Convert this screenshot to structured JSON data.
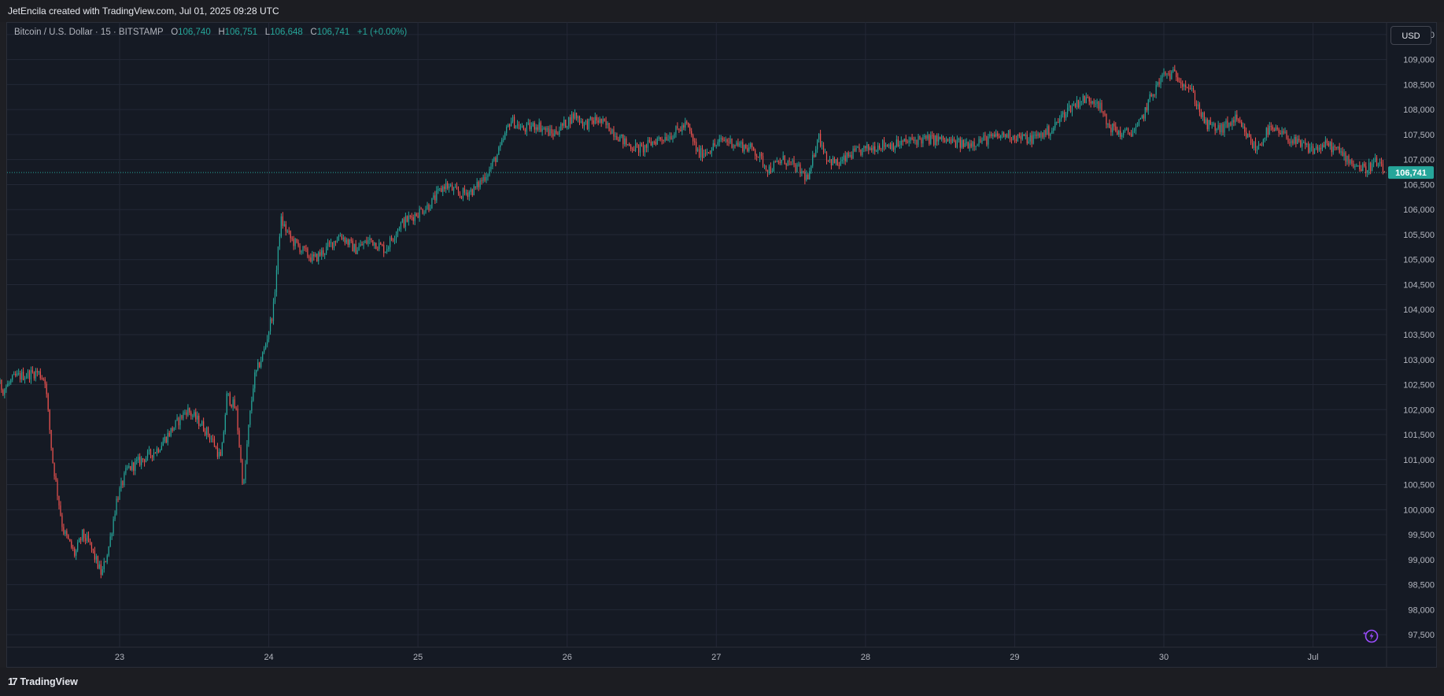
{
  "header": {
    "credit": "JetEncila created with TradingView.com, Jul 01, 2025 09:28 UTC"
  },
  "legend": {
    "symbol": "Bitcoin / U.S. Dollar · 15 · BITSTAMP",
    "o_label": "O",
    "o": "106,740",
    "h_label": "H",
    "h": "106,751",
    "l_label": "L",
    "l": "106,648",
    "c_label": "C",
    "c": "106,741",
    "change": "+1 (+0.00%)"
  },
  "currency_button": "USD",
  "last_price_label": "106,741",
  "footer": {
    "brand": "TradingView",
    "brand_mark": "17"
  },
  "icons": {
    "bolt": "lightning-icon"
  },
  "colors": {
    "up": "#26a69a",
    "down": "#ef5350",
    "background": "#151a24",
    "grid": "#232836"
  },
  "chart_data": {
    "type": "candlestick",
    "title": "Bitcoin / U.S. Dollar · 15 · BITSTAMP",
    "interval": "15",
    "ylim": [
      97250,
      109750
    ],
    "y_ticks": [
      97500,
      98000,
      98500,
      99000,
      99500,
      100000,
      100500,
      101000,
      101500,
      102000,
      102500,
      103000,
      103500,
      104000,
      104500,
      105000,
      105500,
      106000,
      106500,
      107000,
      107500,
      108000,
      108500,
      109000,
      109500
    ],
    "y_tick_labels": [
      "97,500",
      "98,000",
      "98,500",
      "99,000",
      "99,500",
      "100,000",
      "100,500",
      "101,000",
      "101,500",
      "102,000",
      "102,500",
      "103,000",
      "103,500",
      "104,000",
      "104,500",
      "105,000",
      "105,500",
      "106,000",
      "106,500",
      "107,000",
      "107,500",
      "108,000",
      "108,500",
      "109,000",
      "109,500"
    ],
    "x_ticks": [
      {
        "label": "23",
        "day": 23
      },
      {
        "label": "24",
        "day": 24
      },
      {
        "label": "25",
        "day": 25
      },
      {
        "label": "26",
        "day": 26
      },
      {
        "label": "27",
        "day": 27
      },
      {
        "label": "28",
        "day": 28
      },
      {
        "label": "29",
        "day": 29
      },
      {
        "label": "30",
        "day": 30
      },
      {
        "label": "Jul",
        "day": 31
      }
    ],
    "x_start_day": 22.0,
    "x_end_day": 31.55,
    "last_price": 106741,
    "grid": true,
    "price_path": [
      [
        22.0,
        103000
      ],
      [
        22.08,
        102600
      ],
      [
        22.15,
        102700
      ],
      [
        22.22,
        102400
      ],
      [
        22.3,
        102650
      ],
      [
        22.38,
        102700
      ],
      [
        22.45,
        102750
      ],
      [
        22.5,
        102600
      ],
      [
        22.55,
        101000
      ],
      [
        22.62,
        99600
      ],
      [
        22.7,
        99100
      ],
      [
        22.75,
        99500
      ],
      [
        22.8,
        99300
      ],
      [
        22.88,
        98700
      ],
      [
        22.93,
        99300
      ],
      [
        22.98,
        100200
      ],
      [
        23.05,
        100800
      ],
      [
        23.15,
        101000
      ],
      [
        23.25,
        101200
      ],
      [
        23.35,
        101600
      ],
      [
        23.45,
        102000
      ],
      [
        23.55,
        101700
      ],
      [
        23.62,
        101400
      ],
      [
        23.68,
        101000
      ],
      [
        23.72,
        102300
      ],
      [
        23.78,
        102000
      ],
      [
        23.83,
        100400
      ],
      [
        23.86,
        101500
      ],
      [
        23.9,
        102600
      ],
      [
        23.97,
        103200
      ],
      [
        24.03,
        104000
      ],
      [
        24.08,
        105800
      ],
      [
        24.15,
        105400
      ],
      [
        24.22,
        105200
      ],
      [
        24.3,
        105000
      ],
      [
        24.38,
        105200
      ],
      [
        24.48,
        105500
      ],
      [
        24.58,
        105200
      ],
      [
        24.68,
        105400
      ],
      [
        24.78,
        105200
      ],
      [
        24.88,
        105700
      ],
      [
        24.98,
        105900
      ],
      [
        25.08,
        106100
      ],
      [
        25.18,
        106500
      ],
      [
        25.28,
        106300
      ],
      [
        25.38,
        106400
      ],
      [
        25.48,
        106800
      ],
      [
        25.55,
        107200
      ],
      [
        25.62,
        107800
      ],
      [
        25.7,
        107600
      ],
      [
        25.8,
        107700
      ],
      [
        25.9,
        107500
      ],
      [
        25.98,
        107700
      ],
      [
        26.05,
        107900
      ],
      [
        26.12,
        107700
      ],
      [
        26.2,
        107800
      ],
      [
        26.3,
        107600
      ],
      [
        26.4,
        107300
      ],
      [
        26.5,
        107200
      ],
      [
        26.6,
        107400
      ],
      [
        26.7,
        107500
      ],
      [
        26.8,
        107700
      ],
      [
        26.88,
        107100
      ],
      [
        26.95,
        107200
      ],
      [
        27.05,
        107400
      ],
      [
        27.15,
        107300
      ],
      [
        27.25,
        107200
      ],
      [
        27.35,
        106800
      ],
      [
        27.45,
        107000
      ],
      [
        27.55,
        106800
      ],
      [
        27.62,
        106600
      ],
      [
        27.68,
        107500
      ],
      [
        27.75,
        107000
      ],
      [
        27.82,
        106900
      ],
      [
        27.9,
        107100
      ],
      [
        28.0,
        107200
      ],
      [
        28.1,
        107300
      ],
      [
        28.2,
        107300
      ],
      [
        28.35,
        107400
      ],
      [
        28.5,
        107400
      ],
      [
        28.65,
        107300
      ],
      [
        28.8,
        107400
      ],
      [
        28.95,
        107500
      ],
      [
        29.1,
        107400
      ],
      [
        29.25,
        107600
      ],
      [
        29.35,
        108000
      ],
      [
        29.45,
        108200
      ],
      [
        29.55,
        108200
      ],
      [
        29.62,
        107700
      ],
      [
        29.72,
        107500
      ],
      [
        29.82,
        107600
      ],
      [
        29.92,
        108300
      ],
      [
        30.0,
        108700
      ],
      [
        30.08,
        108700
      ],
      [
        30.18,
        108400
      ],
      [
        30.28,
        107700
      ],
      [
        30.38,
        107600
      ],
      [
        30.48,
        107800
      ],
      [
        30.55,
        107500
      ],
      [
        30.62,
        107200
      ],
      [
        30.7,
        107600
      ],
      [
        30.8,
        107500
      ],
      [
        30.9,
        107300
      ],
      [
        31.0,
        107200
      ],
      [
        31.1,
        107300
      ],
      [
        31.2,
        107100
      ],
      [
        31.28,
        106900
      ],
      [
        31.35,
        106800
      ],
      [
        31.42,
        106950
      ],
      [
        31.48,
        106741
      ]
    ]
  }
}
